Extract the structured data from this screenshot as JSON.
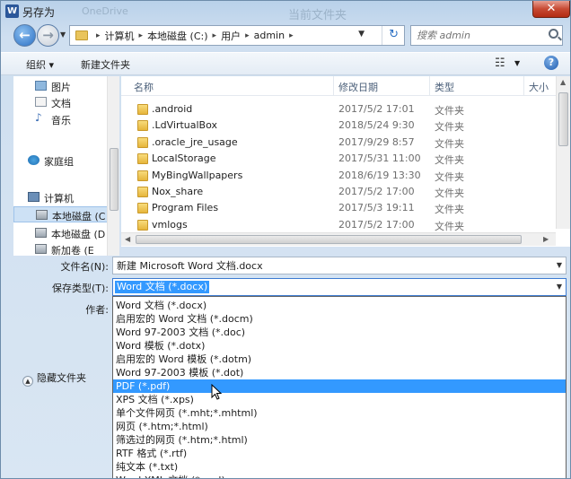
{
  "window": {
    "title": "另存为",
    "ghost_left": "OneDrive",
    "ghost_right": "当前文件夹",
    "close": "✕",
    "icon": "W"
  },
  "address": {
    "crumbs": [
      "计算机",
      "本地磁盘 (C:)",
      "用户",
      "admin"
    ]
  },
  "search": {
    "placeholder": "搜索 admin"
  },
  "toolbar": {
    "organize": "组织 ▾",
    "new_folder": "新建文件夹"
  },
  "nav_pane": {
    "items": [
      {
        "label": "图片",
        "icon": "pictures-icon"
      },
      {
        "label": "文档",
        "icon": "documents-icon"
      },
      {
        "label": "音乐",
        "icon": "music-icon"
      },
      {
        "label": "家庭组",
        "icon": "homegroup-icon"
      },
      {
        "label": "计算机",
        "icon": "computer-icon"
      },
      {
        "label": "本地磁盘 (C",
        "icon": "drive-icon",
        "selected": true
      },
      {
        "label": "本地磁盘 (D",
        "icon": "drive-icon"
      },
      {
        "label": "新加卷 (E",
        "icon": "drive-icon"
      }
    ]
  },
  "columns": {
    "name": "名称",
    "modified": "修改日期",
    "type": "类型",
    "size": "大小"
  },
  "files": [
    {
      "name": ".android",
      "modified": "2017/5/2 17:01",
      "type": "文件夹"
    },
    {
      "name": ".LdVirtualBox",
      "modified": "2018/5/24 9:30",
      "type": "文件夹"
    },
    {
      "name": ".oracle_jre_usage",
      "modified": "2017/9/29 8:57",
      "type": "文件夹"
    },
    {
      "name": "LocalStorage",
      "modified": "2017/5/31 11:00",
      "type": "文件夹"
    },
    {
      "name": "MyBingWallpapers",
      "modified": "2018/6/19 13:30",
      "type": "文件夹"
    },
    {
      "name": "Nox_share",
      "modified": "2017/5/2 17:00",
      "type": "文件夹"
    },
    {
      "name": "Program Files",
      "modified": "2017/5/3 19:11",
      "type": "文件夹"
    },
    {
      "name": "vmlogs",
      "modified": "2017/5/2 17:00",
      "type": "文件夹"
    }
  ],
  "form": {
    "filename_label": "文件名(N):",
    "filename_value": "新建 Microsoft Word 文档.docx",
    "savetype_label": "保存类型(T):",
    "savetype_value": "Word 文档 (*.docx)",
    "author_label": "作者:",
    "hide_folders": "隐藏文件夹"
  },
  "savetype_options": [
    {
      "label": "Word 文档 (*.docx)"
    },
    {
      "label": "启用宏的 Word 文档 (*.docm)"
    },
    {
      "label": "Word 97-2003 文档 (*.doc)"
    },
    {
      "label": "Word 模板 (*.dotx)"
    },
    {
      "label": "启用宏的 Word 模板 (*.dotm)"
    },
    {
      "label": "Word 97-2003 模板 (*.dot)"
    },
    {
      "label": "PDF (*.pdf)",
      "highlighted": true
    },
    {
      "label": "XPS 文档 (*.xps)"
    },
    {
      "label": "单个文件网页 (*.mht;*.mhtml)"
    },
    {
      "label": "网页 (*.htm;*.html)"
    },
    {
      "label": "筛选过的网页 (*.htm;*.html)"
    },
    {
      "label": "RTF 格式 (*.rtf)"
    },
    {
      "label": "纯文本 (*.txt)"
    },
    {
      "label": "Word XML 文档 (*.xml)"
    }
  ],
  "colors": {
    "selection": "#3399ff",
    "highlight_nav": "#cde1f5",
    "frame": "#cfdff0"
  }
}
